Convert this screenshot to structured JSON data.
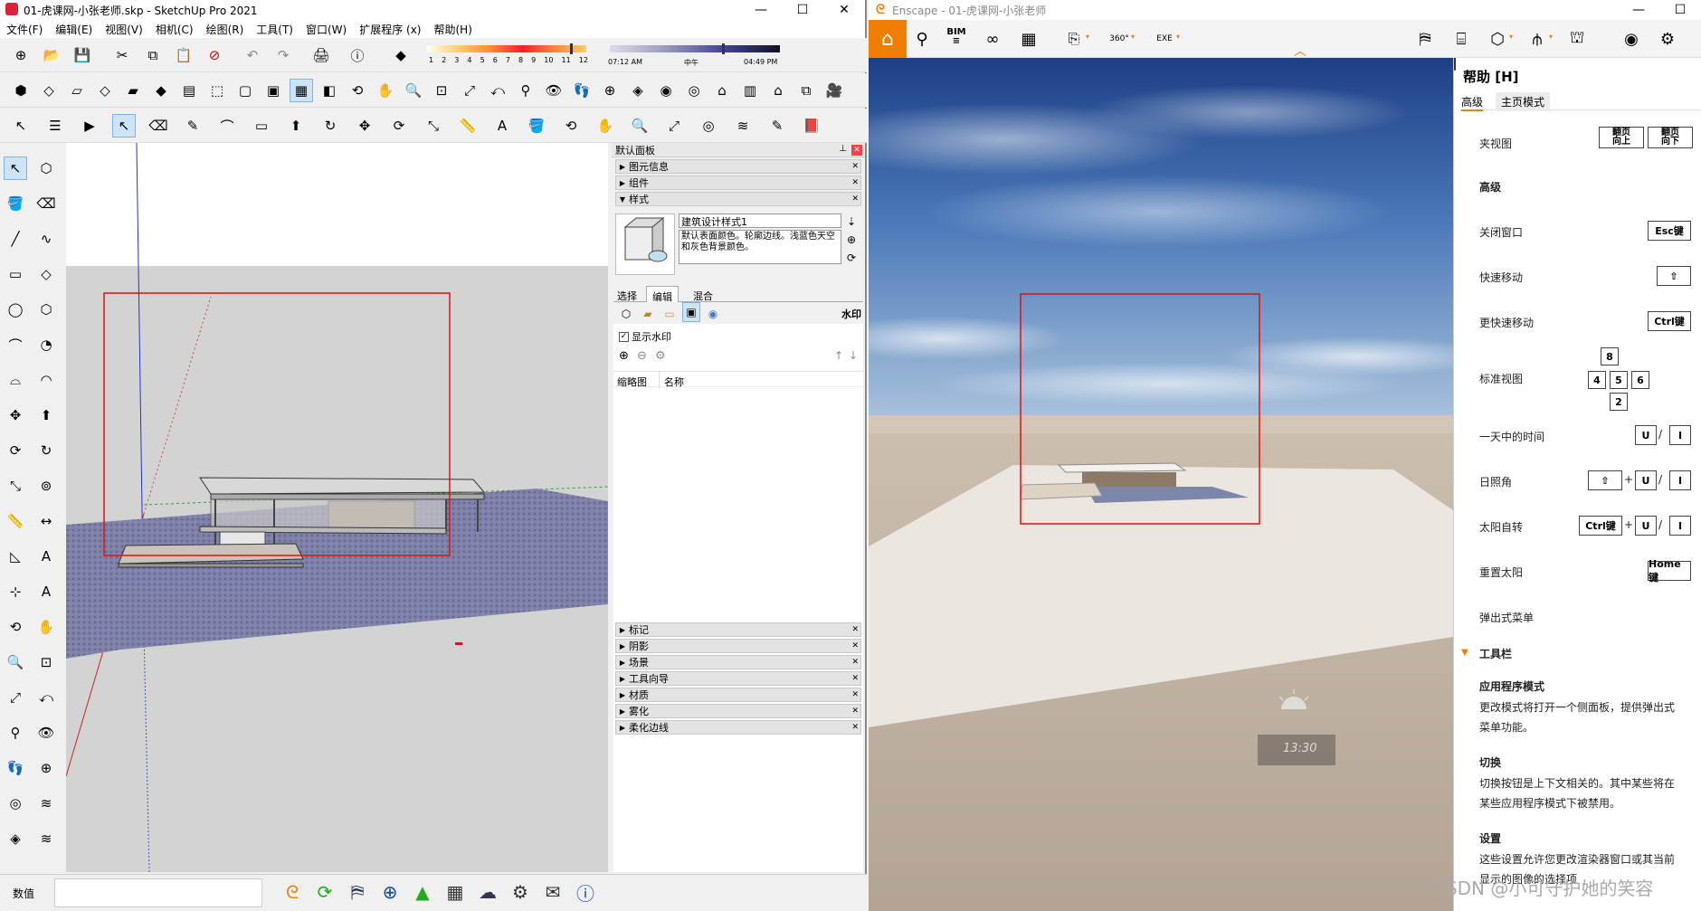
{
  "sketchup": {
    "title": "01-虎课网-小张老师.skp - SketchUp Pro 2021",
    "menu": [
      "文件(F)",
      "编辑(E)",
      "视图(V)",
      "相机(C)",
      "绘图(R)",
      "工具(T)",
      "窗口(W)",
      "扩展程序 (x)",
      "帮助(H)"
    ],
    "months": [
      "1",
      "2",
      "3",
      "4",
      "5",
      "6",
      "7",
      "8",
      "9",
      "10",
      "11",
      "12"
    ],
    "time_start": "07:12 AM",
    "time_mid": "中午",
    "time_end": "04:49 PM",
    "panel_title": "默认面板",
    "tray_top": [
      {
        "label": "图元信息",
        "open": false
      },
      {
        "label": "组件",
        "open": false
      },
      {
        "label": "样式",
        "open": true
      }
    ],
    "style_name": "建筑设计样式1",
    "style_desc": "默认表面颜色。轮廓边线。浅蓝色天空和灰色背景颜色。",
    "style_tabs": [
      "选择",
      "编辑",
      "混合"
    ],
    "watermark_label": "水印",
    "show_watermark": "显示水印",
    "columns": [
      "缩略图",
      "名称"
    ],
    "tray_bottom": [
      "标记",
      "阴影",
      "场景",
      "工具向导",
      "材质",
      "雾化",
      "柔化边线"
    ],
    "status_label": "数值"
  },
  "enscape": {
    "title": "Enscape - 01-虎课网-小张老师",
    "toolbar_icons": [
      "home-icon",
      "pin-icon",
      "bim-icon",
      "binoculars-icon",
      "clapper-icon",
      "export-icon",
      "360-icon",
      "exe-icon"
    ],
    "bim_label": "BIM",
    "help_title": "帮助 [H]",
    "help_tabs": [
      "高级",
      "主页模式"
    ],
    "top_partial": "夹视图",
    "top_keys": [
      "翻页\n向上",
      "翻页\n向下"
    ],
    "section_advanced": "高级",
    "rows": [
      {
        "label": "关闭窗口",
        "keys": [
          "Esc键"
        ]
      },
      {
        "label": "快速移动",
        "keys": [
          "⇧"
        ]
      },
      {
        "label": "更快速移动",
        "keys": [
          "Ctrl键"
        ]
      },
      {
        "label": "标准视图",
        "keys": [
          "8",
          "4",
          "5",
          "6",
          "2"
        ]
      },
      {
        "label": "一天中的时间",
        "keys": [
          "U",
          "I"
        ]
      },
      {
        "label": "日照角",
        "keys": [
          "⇧",
          "U",
          "I"
        ]
      },
      {
        "label": "太阳自转",
        "keys": [
          "Ctrl键",
          "U",
          "I"
        ]
      },
      {
        "label": "重置太阳",
        "keys": [
          "Home键"
        ]
      },
      {
        "label": "弹出式菜单",
        "keys": [
          "mouse"
        ]
      }
    ],
    "section_toolbar": "工具栏",
    "app_mode_title": "应用程序模式",
    "app_mode_desc1": "更改模式将打开一个侧面板，提供弹出式",
    "app_mode_desc2": "菜单功能。",
    "switch_title": "切换",
    "switch_desc1": "切换按钮是上下文相关的。其中某些将在",
    "switch_desc2": "某些应用程序模式下被禁用。",
    "settings_title": "设置",
    "settings_desc1": "这些设置允许您更改渲染器窗口或其当前",
    "settings_desc2": "显示的图像的选择项",
    "time_readout": "13:30",
    "watermark": "CSDN @小可守护她的笑容"
  },
  "colors": {
    "accent": "#f07c00",
    "highlight_box": "#e01010"
  }
}
